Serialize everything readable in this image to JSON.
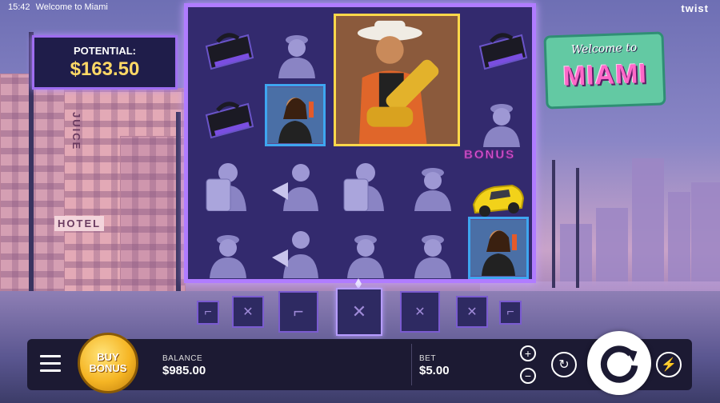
{
  "status_bar": {
    "time": "15:42",
    "title": "Welcome to Miami"
  },
  "brand": "twist",
  "potential": {
    "label": "POTENTIAL:",
    "value": "$163.50"
  },
  "logo": {
    "line1": "Welcome to",
    "line2": "MIAMI"
  },
  "reels": {
    "bonus_label": "BONUS",
    "symbols": [
      "bag",
      "cop",
      "big-gangster",
      "bag",
      "bag",
      "woman",
      "cop",
      "riot-cop",
      "megaphone-cop",
      "riot-cop",
      "cop",
      "bonus-car",
      "cop",
      "megaphone-cop",
      "cop",
      "cop",
      "woman"
    ]
  },
  "lower_slots": [
    "rifle-icon",
    "x",
    "pistol-icon",
    "x",
    "x",
    "x",
    "rifle-icon"
  ],
  "bottom": {
    "buy_bonus_line1": "BUY",
    "buy_bonus_line2": "BONUS",
    "balance_label": "BALANCE",
    "balance_value": "$985.00",
    "bet_label": "BET",
    "bet_value": "$5.00"
  },
  "colors": {
    "accent": "#b07cff",
    "gold": "#ffd966",
    "frame": "#3ea6f0"
  }
}
